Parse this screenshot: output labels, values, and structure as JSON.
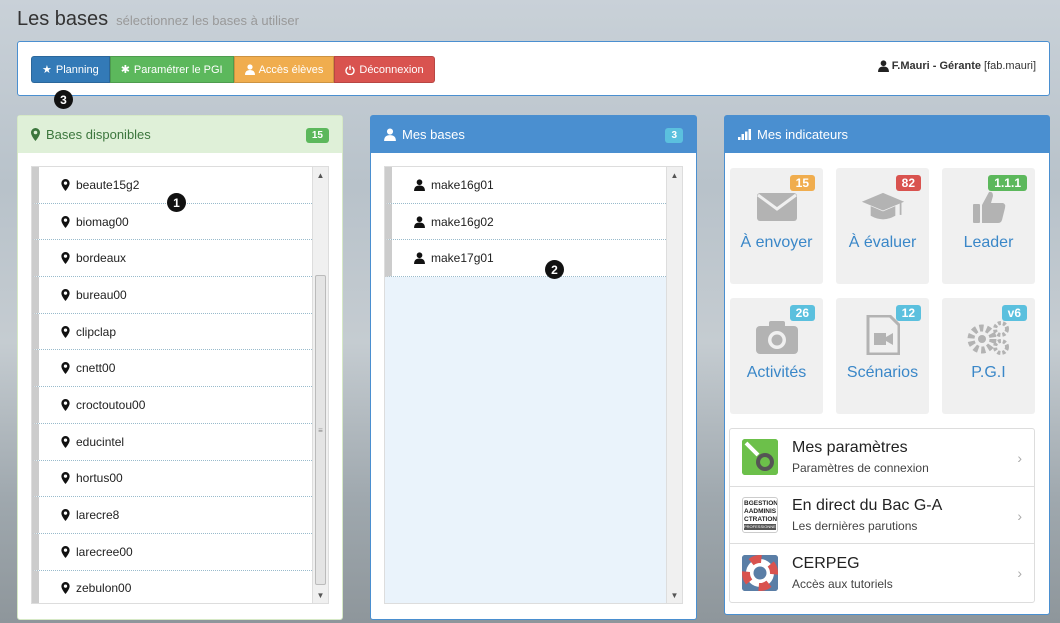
{
  "header": {
    "title": "Les bases",
    "subtitle": "sélectionnez les bases à utiliser"
  },
  "toolbar": {
    "planning": "Planning",
    "parametrer": "Paramétrer le PGI",
    "acces": "Accès élèves",
    "deconnexion": "Déconnexion"
  },
  "user": {
    "name": "F.Mauri - Gérante",
    "login": "[fab.mauri]"
  },
  "markers": {
    "m1": "1",
    "m2": "2",
    "m3": "3"
  },
  "available": {
    "title": "Bases disponibles",
    "count": "15",
    "items": [
      "beaute15g2",
      "biomag00",
      "bordeaux",
      "bureau00",
      "clipclap",
      "cnett00",
      "croctoutou00",
      "educintel",
      "hortus00",
      "larecre8",
      "larecree00",
      "zebulon00"
    ]
  },
  "mine": {
    "title": "Mes bases",
    "count": "3",
    "items": [
      "make16g01",
      "make16g02",
      "make17g01"
    ]
  },
  "indicators": {
    "title": "Mes indicateurs",
    "tiles": [
      {
        "label": "À envoyer",
        "badge": "15",
        "badge_color": "#f0ad4e",
        "icon": "envelope-icon"
      },
      {
        "label": "À évaluer",
        "badge": "82",
        "badge_color": "#d9534f",
        "icon": "graduation-cap-icon"
      },
      {
        "label": "Leader",
        "badge": "1.1.1",
        "badge_color": "#5cb85c",
        "icon": "thumbs-up-icon"
      },
      {
        "label": "Activités",
        "badge": "26",
        "badge_color": "#5bc0de",
        "icon": "camera-icon"
      },
      {
        "label": "Scénarios",
        "badge": "12",
        "badge_color": "#5bc0de",
        "icon": "video-file-icon"
      },
      {
        "label": "P.G.I",
        "badge": "v6",
        "badge_color": "#5bc0de",
        "icon": "gears-icon"
      }
    ],
    "links": [
      {
        "title": "Mes paramètres",
        "sub": "Paramètres de connexion"
      },
      {
        "title": "En direct du Bac G-A",
        "sub": "Les dernières parutions",
        "logo_text": [
          "BGESTION",
          "AADMINIS",
          "CTRATION",
          "PROFESSIONNEL"
        ]
      },
      {
        "title": "CERPEG",
        "sub": "Accès aux tutoriels"
      }
    ]
  },
  "colors": {
    "primary": "#4a8fd0",
    "success_bg": "#dff0d8",
    "success_text": "#3c763d",
    "tile_text": "#3a87c8"
  }
}
